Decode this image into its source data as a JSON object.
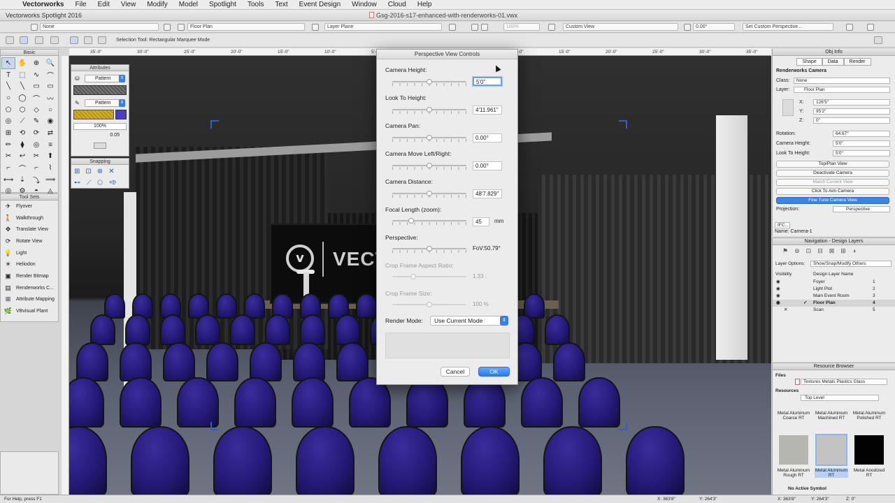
{
  "menubar": {
    "app": "Vectorworks",
    "items": [
      "File",
      "Edit",
      "View",
      "Modify",
      "Model",
      "Spotlight",
      "Tools",
      "Text",
      "Event Design",
      "Window",
      "Cloud",
      "Help"
    ]
  },
  "window": {
    "app_title": "Vectorworks Spotlight 2016",
    "doc_title": "Gsg-2016-s17-enhanced-with-renderworks-01.vwx"
  },
  "viewbar": {
    "class_field": "None",
    "layer_field": "Floor Plan",
    "layer_plane": "Layer Plane",
    "zoom": "100%",
    "view": "Custom View",
    "angle": "0.00°",
    "perspective": "Set Custom Perspective..."
  },
  "modebar": {
    "hint": "Selection Tool: Rectangular Marquee Mode"
  },
  "ruler": {
    "labels": [
      "35'-0\"",
      "30'-0\"",
      "25'-0\"",
      "20'-0\"",
      "15'-0\"",
      "10'-0\"",
      "5'-0\"",
      "0'-0\"",
      "5'-0\"",
      "10'-0\"",
      "15'-0\"",
      "20'-0\"",
      "25'-0\"",
      "30'-0\"",
      "35'-0\""
    ]
  },
  "basic_palette": {
    "title": "Basic",
    "tools": [
      "↖",
      "✋",
      "⊕",
      "🔍",
      "T",
      "⬚",
      "∿",
      "⌒",
      "╲",
      "╲",
      "▭",
      "▭",
      "○",
      "◯",
      "⌒",
      "〰",
      "⬠",
      "⬡",
      "◇",
      "○",
      "◎",
      "⟋",
      "✎",
      "◉",
      "⊞",
      "⟲",
      "⟳",
      "⇄",
      "✏",
      "⧫",
      "◎",
      "≡",
      "✂",
      "↩",
      "✂",
      "⬆",
      "⌐",
      "⌒",
      "⌐",
      "⌇",
      "⟷",
      "⇣",
      "⤵",
      "⟹",
      "◎",
      "⚙",
      "◓",
      "◬"
    ],
    "toolsets_title": "Tool Sets",
    "toolsets": [
      {
        "label": "Flyover",
        "icon": "flyover-icon"
      },
      {
        "label": "Walkthrough",
        "icon": "walkthrough-icon"
      },
      {
        "label": "Translate View",
        "icon": "translate-view-icon"
      },
      {
        "label": "Rotate View",
        "icon": "rotate-view-icon"
      },
      {
        "label": "Light",
        "icon": "light-icon"
      },
      {
        "label": "Heliodon",
        "icon": "heliodon-icon"
      },
      {
        "label": "Render Bitmap",
        "icon": "render-bitmap-icon"
      },
      {
        "label": "Renderworks C...",
        "icon": "renderworks-camera-icon"
      },
      {
        "label": "Attribute Mapping",
        "icon": "attribute-mapping-icon"
      },
      {
        "label": "VBvisual Plant",
        "icon": "vbvisual-plant-icon"
      }
    ]
  },
  "attributes": {
    "title": "Attributes",
    "fill_style": "Pattern",
    "pen_style": "Pattern",
    "opacity": "100%",
    "thickness": "0.05"
  },
  "snapping": {
    "title": "Snapping"
  },
  "obj_info": {
    "title": "Obj Info",
    "tabs": [
      "Shape",
      "Data",
      "Render"
    ],
    "object_type": "Renderworks Camera",
    "class_label": "Class:",
    "class_value": "None",
    "layer_label": "Layer:",
    "layer_value": "Floor Plan",
    "x_label": "X:",
    "x_value": "126'5\"",
    "y_label": "Y:",
    "y_value": "95'2\"",
    "z_label": "Z:",
    "z_value": "0\"",
    "rotation_label": "Rotation:",
    "rotation_value": "64.67°",
    "cam_height_label": "Camera Height:",
    "cam_height_value": "5'0\"",
    "look_height_label": "Look To Height:",
    "look_height_value": "5'0\"",
    "buttons": [
      "Top/Plan View",
      "Deactivate Camera",
      "Match Current View",
      "Click To Aim Camera",
      "Fine Tune Camera View"
    ],
    "projection_label": "Projection:",
    "projection_value": "Perspective",
    "ifc": "IFC...",
    "name": "Name: Camera-1"
  },
  "navigation": {
    "title": "Navigation - Design Layers",
    "options_label": "Layer Options:",
    "options_value": "Show/Snap/Modify Others",
    "col_visibility": "Visibility",
    "col_name": "Design Layer Name",
    "layers": [
      {
        "name": "Foyer",
        "num": "1",
        "selected": false
      },
      {
        "name": "Light Plot",
        "num": "2",
        "selected": false
      },
      {
        "name": "Main Event Room",
        "num": "3",
        "selected": false
      },
      {
        "name": "Floor Plan",
        "num": "4",
        "selected": true
      },
      {
        "name": "Scan",
        "num": "5",
        "selected": false
      }
    ]
  },
  "resource_browser": {
    "title": "Resource Browser",
    "files_label": "Files",
    "file_value": "Textures Metals Plastics Glass",
    "resources_label": "Resources",
    "level": "Top Level",
    "items": [
      {
        "label": "Metal Aluminum Coarse RT"
      },
      {
        "label": "Metal Aluminum Machined RT"
      },
      {
        "label": "Metal Aluminum Polished RT"
      },
      {
        "label": "Metal Aluminum Rough RT",
        "color": "#b6b6b0"
      },
      {
        "label": "Metal Aluminum RT",
        "color": "#c3c3c3"
      },
      {
        "label": "Metal Anodized RT",
        "color": "#020202"
      }
    ],
    "no_active": "No Active Symbol"
  },
  "status": {
    "hint": "For Help, press F1",
    "x": "X: 363'8\"",
    "y": "Y: 264'3\"",
    "x2": "X: 363'8\"",
    "y2": "Y: 264'3\"",
    "z": "Z: 0\""
  },
  "dialog": {
    "title": "Perspective View Controls",
    "camera_height_label": "Camera Height:",
    "camera_height_value": "5'0\"",
    "look_height_label": "Look To Height:",
    "look_height_value": "4'11.961\"",
    "pan_label": "Camera Pan:",
    "pan_value": "0.00°",
    "move_label": "Camera Move Left/Right:",
    "move_value": "0.00°",
    "distance_label": "Camera Distance:",
    "distance_value": "48'7.829\"",
    "focal_label": "Focal Length (zoom):",
    "focal_value": "45",
    "focal_unit": "mm",
    "perspective_label": "Perspective:",
    "perspective_value": "FoV:50.79°",
    "aspect_label": "Crop Frame Aspect Ratio:",
    "aspect_value": "1.33 :",
    "crop_size_label": "Crop Frame Size:",
    "crop_size_value": "100 %",
    "render_mode_label": "Render Mode:",
    "render_mode_value": "Use Current Mode",
    "cancel": "Cancel",
    "ok": "OK",
    "slider_levels": {
      "camera_height": 0.5,
      "look_height": 0.5,
      "pan": 0.5,
      "move": 0.5,
      "distance": 0.5,
      "focal": 0.25,
      "perspective": 0.5,
      "aspect": 0.28,
      "crop_size": 0.5
    }
  },
  "colors": {
    "accent": "#3f7fdc",
    "chair": "#2a1f8a",
    "crop": "#2b61c9"
  }
}
